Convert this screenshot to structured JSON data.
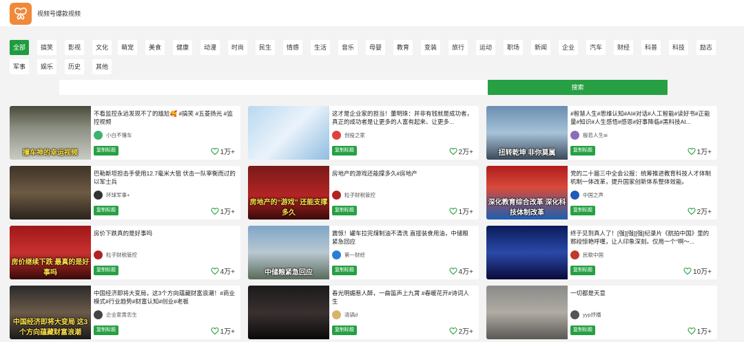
{
  "header": {
    "title": "视频号爆款视频"
  },
  "categories": [
    "全部",
    "搞笑",
    "影视",
    "文化",
    "萌宠",
    "美食",
    "健康",
    "动漫",
    "时尚",
    "民生",
    "情感",
    "生活",
    "音乐",
    "母婴",
    "教育",
    "变装",
    "旅行",
    "运动",
    "职场",
    "新闻",
    "企业",
    "汽车",
    "财经",
    "科普",
    "科技",
    "励志",
    "军事",
    "娱乐",
    "历史",
    "其他"
  ],
  "active_category": "全部",
  "search": {
    "placeholder": "",
    "button_label": "搜索"
  },
  "copy_label": "复制标题",
  "cards": [
    {
      "title": "不看监控永远发现不了的尴尬🥰 #搞笑 #五菱扬光 #监控视频",
      "author": "小白不懂车",
      "likes": "1万+",
      "thumb_caption": "撞车神的幸运视频",
      "avatar_color": "#3cb371"
    },
    {
      "title": "这才是企业家的担当！董明珠：并非有钱就是成功者，真正的成功者是让更多的人富有起来、让更多...",
      "author": "创投之家",
      "likes": "2万+",
      "thumb_caption": "",
      "avatar_color": "#e04040"
    },
    {
      "title": "#智慧人生#思维认知#AI#对话#人工智能#读好书#正能量#知识#人生感悟#感恩#好事降临#黑科技AI...",
      "author": "殷若人生ai",
      "likes": "1万+",
      "thumb_caption": "扭转乾坤 非你莫属",
      "avatar_color": "#8a6db8"
    },
    {
      "title": "巴勒斯坦担击手使用12.7毫米大狙 伏击一队宰衡而过的以军士兵",
      "author": "环球军事+",
      "likes": "1万+",
      "thumb_caption": "",
      "avatar_color": "#333333"
    },
    {
      "title": "房地产的游戏还能撑多久#房地产",
      "author": "粒子财税管控",
      "likes": "1万+",
      "thumb_caption": "房地产的“游戏” 还能支撑多久",
      "avatar_color": "#b22222"
    },
    {
      "title": "党的二十届三中全会公报：统筹推进教育科技人才体制机制一体改革，提升国家创新体系整体效能。",
      "author": "中国之声",
      "likes": "2万+",
      "thumb_caption": "深化教育综合改革 深化科技体制改革",
      "avatar_color": "#1e5bb8"
    },
    {
      "title": "房价下跌真的是好事吗",
      "author": "粒子财税管控",
      "likes": "4万+",
      "thumb_caption": "房价继续下跌 最真的是好事吗",
      "avatar_color": "#b22222"
    },
    {
      "title": "震惊！罐车拉完煤制油不清洗 直接装食用油，中储粮紧急回应",
      "author": "第一财经",
      "likes": "4万+",
      "thumb_caption": "中储粮紧急回应",
      "avatar_color": "#2a7fd4"
    },
    {
      "title": "终于见到真人了！[强][强][强]纪录片《航拍中国》里的那段惊艳呼嘆，让人印象深刻。仅用一个“啊～...",
      "author": "民歌中国",
      "likes": "10万+",
      "thumb_caption": "",
      "avatar_color": "#c0392b"
    },
    {
      "title": "中国经济即将大变局，这3个方向蕴藏财富浪潮！#商业模式#行业趋势#财富认知#创业#老板",
      "author": "企业家黄忠生",
      "likes": "1万+",
      "thumb_caption": "中国经济即将大变局 这3个方向蕴藏财富浪潮",
      "avatar_color": "#444444"
    },
    {
      "title": "春光明媚惹人醉，一曲笛声上九霄 #春暖花开#诗词人生",
      "author": "清锅d",
      "likes": "2万+",
      "thumb_caption": "",
      "avatar_color": "#d8b36a"
    },
    {
      "title": "一切都是天意",
      "author": "yyp抒播",
      "likes": "1万+",
      "thumb_caption": "",
      "avatar_color": "#555555"
    }
  ],
  "colors": {
    "accent": "#26a043",
    "logo": "#f0893a",
    "background": "#f3f3f3"
  }
}
